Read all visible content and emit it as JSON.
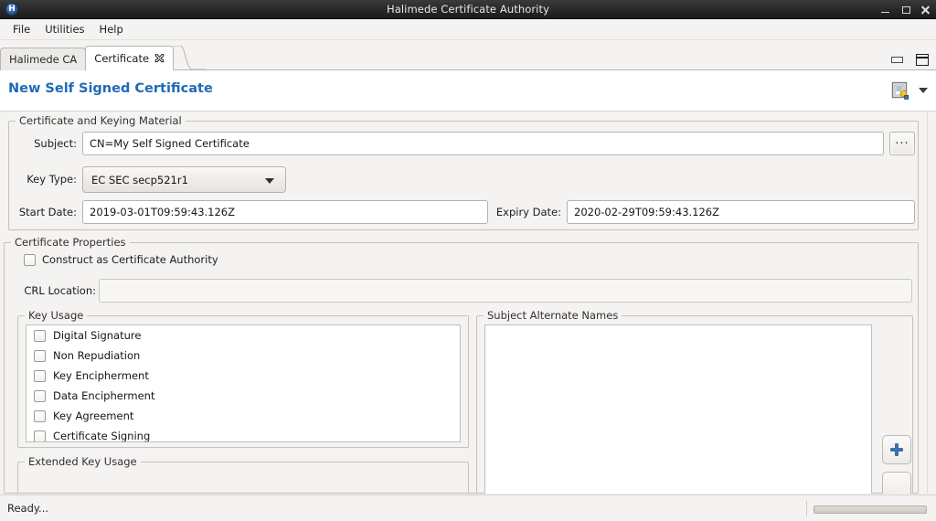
{
  "window": {
    "title": "Halimede Certificate Authority",
    "app_badge": "H",
    "controls": {
      "minimize": "minimize-icon",
      "restore": "restore-icon",
      "close": "close-icon"
    }
  },
  "menubar": {
    "items": [
      {
        "label": "File"
      },
      {
        "label": "Utilities"
      },
      {
        "label": "Help"
      }
    ]
  },
  "tabs": {
    "items": [
      {
        "label": "Halimede CA",
        "active": false,
        "closable": false
      },
      {
        "label": "Certificate",
        "active": true,
        "closable": true
      }
    ],
    "view_buttons": [
      {
        "name": "minimize-view-button"
      },
      {
        "name": "maximize-view-button"
      }
    ]
  },
  "form": {
    "title": "New Self Signed Certificate",
    "toolbar": {
      "certificate_icon": "certificate-icon",
      "menu_arrow": "chevron-down-icon"
    },
    "keying_group": {
      "legend": "Certificate and Keying Material",
      "subject_label": "Subject:",
      "subject_value": "CN=My Self Signed Certificate",
      "subject_browse_label": "...",
      "key_type_label": "Key Type:",
      "key_type_value": "EC SEC secp521r1",
      "start_date_label": "Start Date:",
      "start_date_value": "2019-03-01T09:59:43.126Z",
      "expiry_date_label": "Expiry Date:",
      "expiry_date_value": "2020-02-29T09:59:43.126Z"
    },
    "properties_group": {
      "legend": "Certificate Properties",
      "construct_ca_label": "Construct as Certificate Authority",
      "construct_ca_checked": false,
      "crl_location_label": "CRL Location:",
      "crl_location_value": "",
      "crl_location_placeholder": ""
    },
    "key_usage_group": {
      "legend": "Key Usage",
      "items": [
        {
          "label": "Digital Signature",
          "checked": false
        },
        {
          "label": "Non Repudiation",
          "checked": false
        },
        {
          "label": "Key Encipherment",
          "checked": false
        },
        {
          "label": "Data Encipherment",
          "checked": false
        },
        {
          "label": "Key Agreement",
          "checked": false
        },
        {
          "label": "Certificate Signing",
          "checked": false
        }
      ]
    },
    "extended_key_usage_group": {
      "legend": "Extended Key Usage"
    },
    "san_group": {
      "legend": "Subject Alternate Names",
      "entries": [],
      "add_button": "add-icon"
    }
  },
  "statusbar": {
    "message": "Ready...",
    "progress_percent": 0
  }
}
